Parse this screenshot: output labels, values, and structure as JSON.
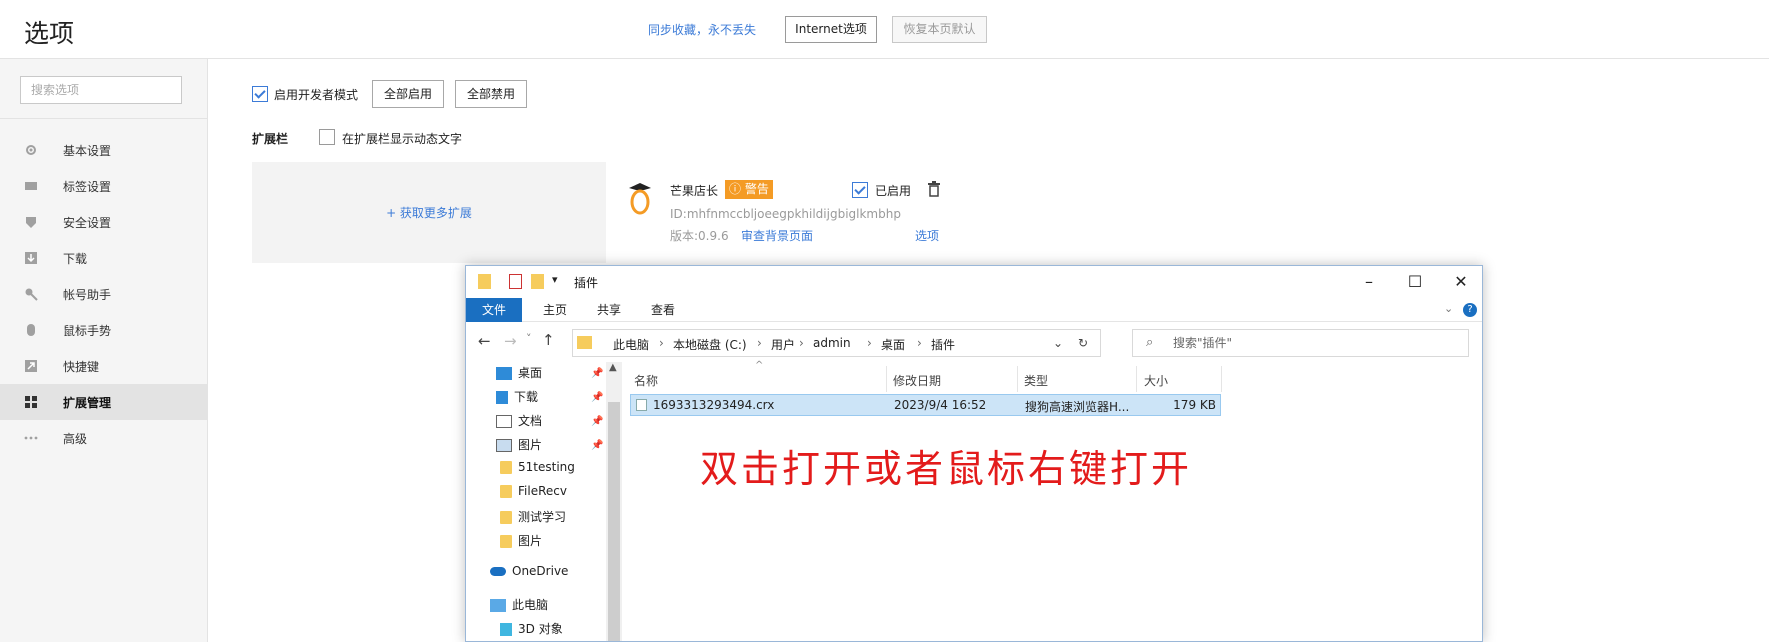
{
  "header": {
    "title": "选项",
    "sync_text": "同步收藏，永不丢失",
    "internet_options": "Internet选项",
    "restore_defaults": "恢复本页默认"
  },
  "sidebar": {
    "search_placeholder": "搜索选项",
    "items": [
      {
        "label": "基本设置",
        "icon": "gear-icon"
      },
      {
        "label": "标签设置",
        "icon": "tab-icon"
      },
      {
        "label": "安全设置",
        "icon": "shield-icon"
      },
      {
        "label": "下载",
        "icon": "download-icon"
      },
      {
        "label": "帐号助手",
        "icon": "key-icon"
      },
      {
        "label": "鼠标手势",
        "icon": "mouse-icon"
      },
      {
        "label": "快捷键",
        "icon": "shortcut-icon"
      },
      {
        "label": "扩展管理",
        "icon": "extensions-icon",
        "active": true
      },
      {
        "label": "高级",
        "icon": "more-icon"
      }
    ]
  },
  "main": {
    "dev_mode_label": "启用开发者模式",
    "enable_all": "全部启用",
    "disable_all": "全部禁用",
    "ext_bar_label": "扩展栏",
    "show_dynamic_text": "在扩展栏显示动态文字",
    "get_more": "+ 获取更多扩展",
    "extension": {
      "name": "芒果店长",
      "warning_badge": "警告",
      "enabled_label": "已启用",
      "id_text": "ID:mhfnmccbljoeegpkhildijgbiglkmbhp",
      "version": "版本:0.9.6",
      "view_background": "审查背景页面",
      "options": "选项"
    }
  },
  "explorer": {
    "title": "插件",
    "ribbon_tabs": [
      "文件",
      "主页",
      "共享",
      "查看"
    ],
    "path": [
      "此电脑",
      "本地磁盘 (C:)",
      "用户",
      "admin",
      "桌面",
      "插件"
    ],
    "search_placeholder": "搜索\"插件\"",
    "tree": [
      {
        "label": "桌面",
        "pinned": true
      },
      {
        "label": "下载",
        "pinned": true
      },
      {
        "label": "文档",
        "pinned": true
      },
      {
        "label": "图片",
        "pinned": true
      },
      {
        "label": "51testing"
      },
      {
        "label": "FileRecv"
      },
      {
        "label": "测试学习"
      },
      {
        "label": "图片"
      },
      {
        "label": "OneDrive"
      },
      {
        "label": "此电脑"
      },
      {
        "label": "3D 对象"
      }
    ],
    "columns": [
      "名称",
      "修改日期",
      "类型",
      "大小"
    ],
    "files": [
      {
        "name": "1693313293494.crx",
        "date": "2023/9/4 16:52",
        "type": "搜狗高速浏览器H...",
        "size": "179 KB"
      }
    ]
  },
  "annotation": "双击打开或者鼠标右键打开",
  "colors": {
    "accent": "#3c7bd7",
    "warning": "#f49b25",
    "annotation": "#e31b1b",
    "ribbon_file": "#1a6fc1"
  }
}
